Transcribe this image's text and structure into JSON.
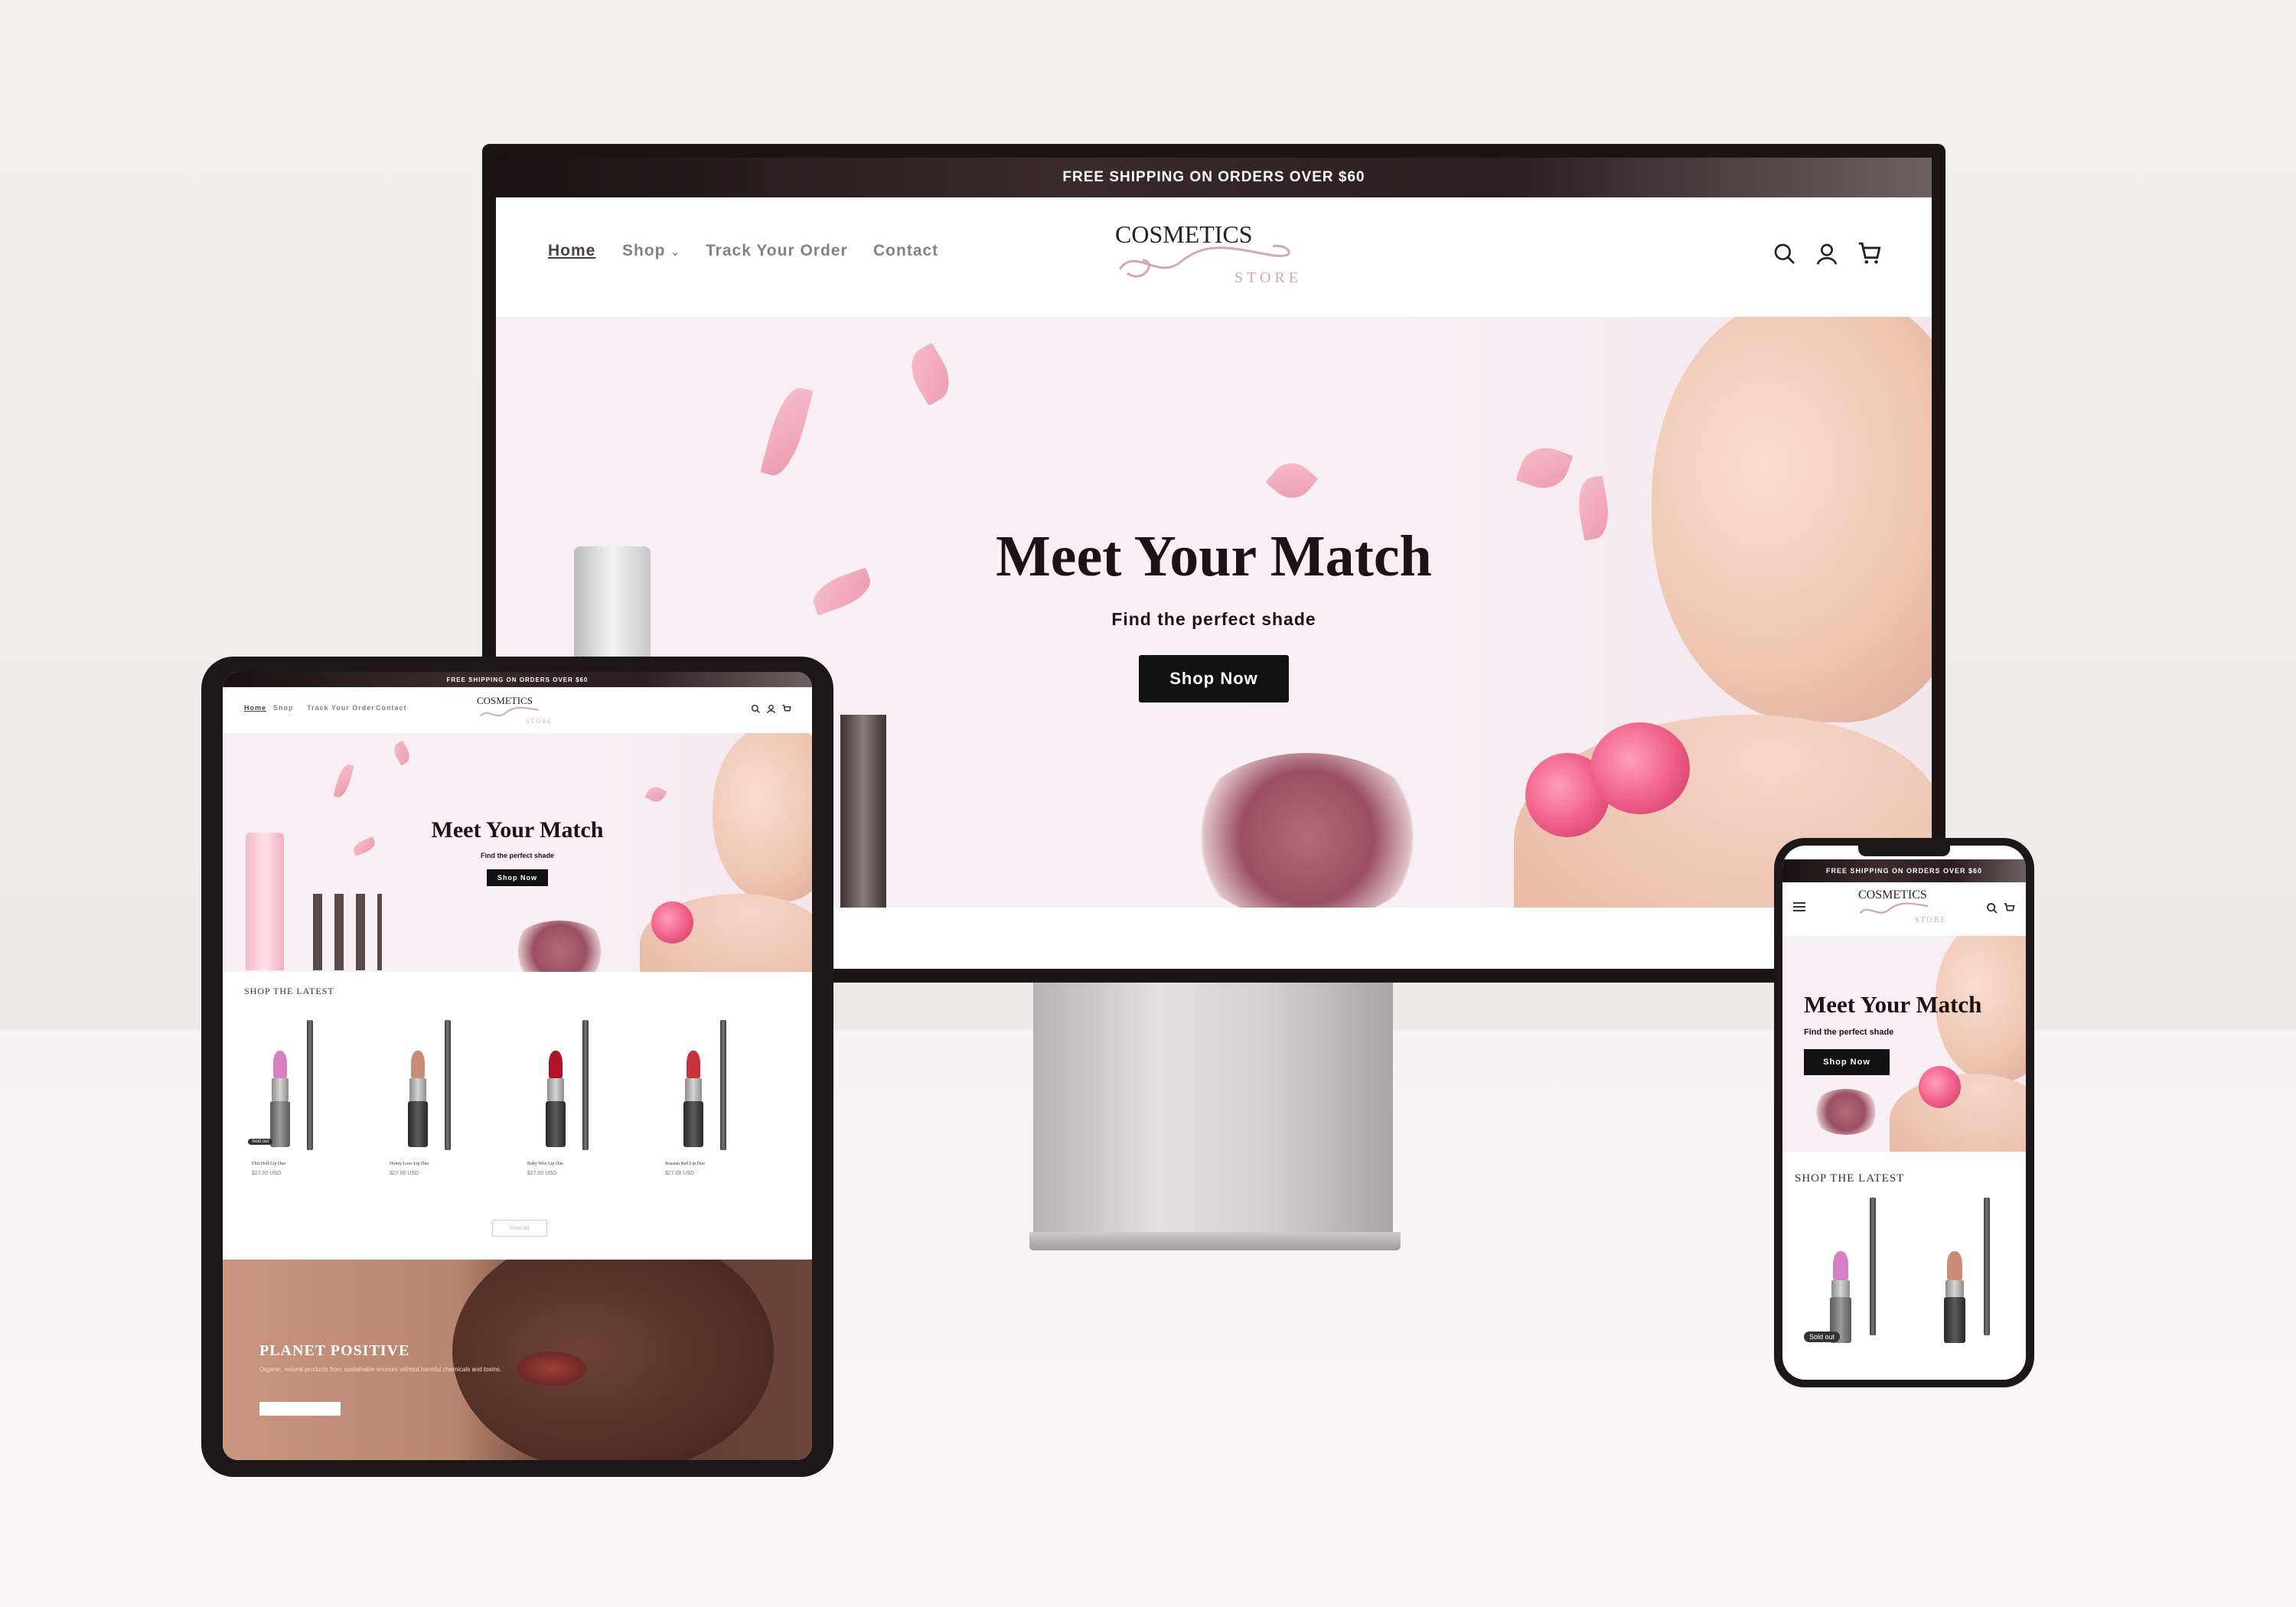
{
  "colors": {
    "banner": "#1b1013",
    "accent_pink": "#e98aa2",
    "button": "#111111",
    "text_muted": "#8a7f80"
  },
  "desktop": {
    "banner": "FREE SHIPPING ON ORDERS OVER $60",
    "nav": {
      "home": "Home",
      "shop": "Shop",
      "track": "Track Your Order",
      "contact": "Contact"
    },
    "logo": {
      "line1": "COSMETICS",
      "line2": "STORE"
    },
    "icons": [
      "search-icon",
      "account-icon",
      "cart-icon"
    ],
    "hero": {
      "title": "Meet Your Match",
      "subtitle": "Find the perfect shade",
      "button": "Shop Now"
    }
  },
  "tablet": {
    "banner": "FREE SHIPPING ON ORDERS OVER $60",
    "nav": {
      "home": "Home",
      "shop": "Shop",
      "track": "Track Your Order",
      "contact": "Contact"
    },
    "logo": {
      "line1": "COSMETICS",
      "line2": "STORE"
    },
    "hero": {
      "title": "Meet Your Match",
      "subtitle": "Find the perfect shade",
      "button": "Shop Now"
    },
    "section_title": "SHOP THE LATEST",
    "products": [
      {
        "name": "Flirt Doll Lip Duo",
        "price": "$27.00 USD",
        "badge": "Sold out",
        "color": "#d67fc2"
      },
      {
        "name": "Honey Love Lip Duo",
        "price": "$27.00 USD",
        "badge": "",
        "color": "#cc8b76"
      },
      {
        "name": "Ruby Woo Lip Duo",
        "price": "$27.00 USD",
        "badge": "",
        "color": "#b0122a"
      },
      {
        "name": "Russian Red Lip Duo",
        "price": "$27.00 USD",
        "badge": "",
        "color": "#c8323d"
      }
    ],
    "view_all": "View All",
    "promo": {
      "title": "PLANET POSITIVE",
      "text": "Organic, natural products from sustainable sources without harmful chemicals and toxins."
    }
  },
  "phone": {
    "banner": "FREE SHIPPING ON ORDERS OVER $60",
    "logo": {
      "line1": "COSMETICS",
      "line2": "STORE"
    },
    "hero": {
      "title": "Meet Your Match",
      "subtitle": "Find the perfect shade",
      "button": "Shop Now"
    },
    "section_title": "SHOP THE LATEST",
    "products": [
      {
        "badge": "Sold out",
        "color": "#d67fc2"
      },
      {
        "badge": "",
        "color": "#cc8b76"
      }
    ]
  }
}
